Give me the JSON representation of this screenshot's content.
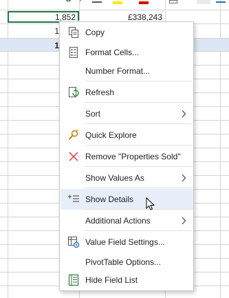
{
  "sheet": {
    "cells": {
      "r1_c1": "1,852",
      "r1_c2": "£338,243",
      "r2_c1": "1",
      "total_partial": "1"
    }
  },
  "menu": {
    "items": [
      {
        "key": "copy",
        "label": "Copy",
        "icon": "copy-icon",
        "submenu": false
      },
      {
        "key": "format_cells",
        "label": "Format Cells...",
        "icon": "format-cells-icon",
        "submenu": false
      },
      {
        "key": "number_format",
        "label": "Number Format...",
        "icon": "",
        "submenu": false
      },
      {
        "key": "refresh",
        "label": "Refresh",
        "icon": "refresh-icon",
        "submenu": false
      },
      {
        "key": "sort",
        "label": "Sort",
        "icon": "",
        "submenu": true
      },
      {
        "key": "quick_explore",
        "label": "Quick Explore",
        "icon": "quick-explore-icon",
        "submenu": false
      },
      {
        "key": "remove",
        "label": "Remove \"Properties Sold\"",
        "icon": "remove-icon",
        "submenu": false
      },
      {
        "key": "show_values_as",
        "label": "Show Values As",
        "icon": "",
        "submenu": true
      },
      {
        "key": "show_details",
        "label": "Show Details",
        "icon": "show-details-icon",
        "submenu": false,
        "highlighted": true
      },
      {
        "key": "additional_actions",
        "label": "Additional Actions",
        "icon": "",
        "submenu": true
      },
      {
        "key": "value_field_settings",
        "label": "Value Field Settings...",
        "icon": "value-field-settings-icon",
        "submenu": false
      },
      {
        "key": "pivottable_options",
        "label": "PivotTable Options...",
        "icon": "",
        "submenu": false
      },
      {
        "key": "hide_field_list",
        "label": "Hide Field List",
        "icon": "field-list-icon",
        "submenu": false
      }
    ]
  },
  "colors": {
    "accent_green": "#217346",
    "highlight": "#e8eef9",
    "total_band": "#dce6f4",
    "remove_red": "#d9534f"
  }
}
